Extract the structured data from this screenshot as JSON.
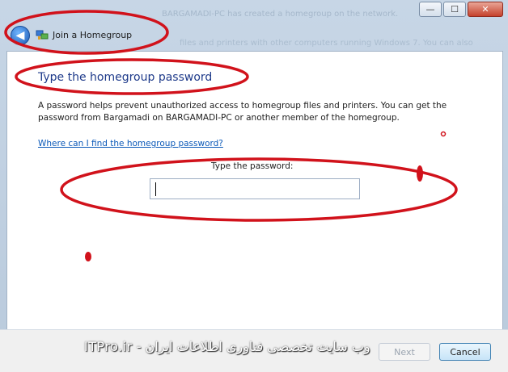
{
  "window": {
    "background_title_fragment": "BARGAMADI-PC has created a homegroup on the network.",
    "background_line_fragment": "files and printers with other computers running Windows 7. You can also"
  },
  "caption_buttons": {
    "minimize": "—",
    "maximize": "☐",
    "close": "✕"
  },
  "nav": {
    "back_symbol": "◀",
    "title": "Join a Homegroup"
  },
  "content": {
    "heading": "Type the homegroup password",
    "description": "A password helps prevent unauthorized access to homegroup files and printers. You can get the password from Bargamadi on BARGAMADI-PC or another member of the homegroup.",
    "help_link": "Where can I find the homegroup password?",
    "password_label": "Type the password:",
    "password_value": ""
  },
  "footer": {
    "next_label": "Next",
    "cancel_label": "Cancel"
  },
  "watermark": "وب سایت تخصصی فناوری اطلاعات ایران - ITPro.ir",
  "colors": {
    "annotation_red": "#d1121b",
    "heading_blue": "#1e3a8a",
    "link_blue": "#0b59b8"
  }
}
